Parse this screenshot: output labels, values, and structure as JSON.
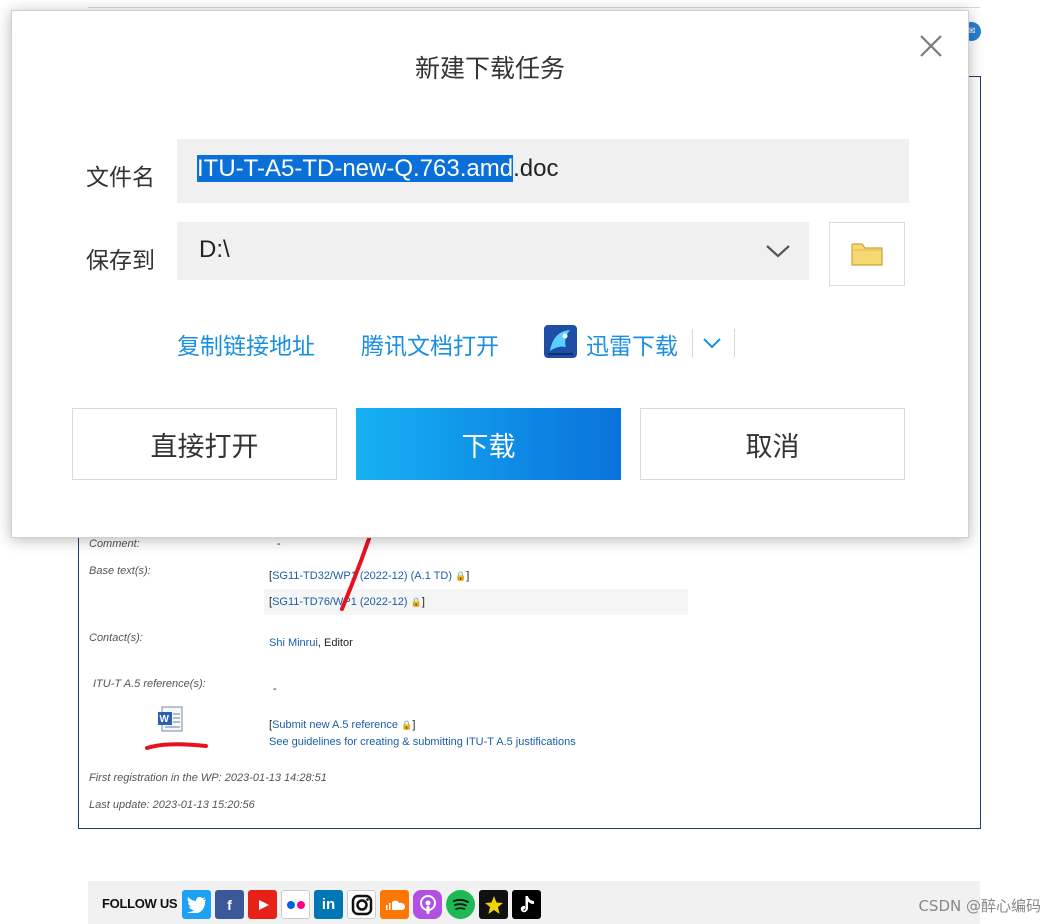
{
  "dialog": {
    "title": "新建下载任务",
    "filename_label": "文件名",
    "filename_selected": "ITU-T-A5-TD-new-Q.763.amd",
    "filename_ext": ".doc",
    "savepath_label": "保存到",
    "savepath_value": "D:\\",
    "links": {
      "copy_link": "复制链接地址",
      "tencent_docs": "腾讯文档打开",
      "xunlei": "迅雷下载"
    },
    "buttons": {
      "open_direct": "直接打开",
      "download": "下载",
      "cancel": "取消"
    },
    "icons": {
      "close": "close-icon",
      "dropdown": "chevron-down-icon",
      "folder": "folder-icon",
      "xunlei": "xunlei-icon"
    }
  },
  "page": {
    "comment_label": "Comment:",
    "comment_value": "-",
    "base_text_label": "Base text(s):",
    "base_text_1_bracket_open": "[",
    "base_text_1": "SG11-TD32/WP1 (2022-12) (A.1 TD)",
    "base_text_1_bracket_close": "]",
    "base_text_2_bracket_open": "[",
    "base_text_2": "SG11-TD76/WP1 (2022-12)",
    "base_text_2_bracket_close": "]",
    "contacts_label": "Contact(s):",
    "contact_name": "Shi Minrui",
    "contact_role": ", Editor",
    "a5_label": "ITU-T A.5 reference(s):",
    "a5_value": "-",
    "submit_bracket_open": "[",
    "submit_link": "Submit new A.5 reference",
    "submit_bracket_close": "]",
    "guidelines_link": "See guidelines for creating & submitting ITU-T A.5 justifications",
    "first_registration": "First registration in the WP: 2023-01-13 14:28:51",
    "last_update": "Last update: 2023-01-13 15:20:56"
  },
  "social": {
    "follow_label": "FOLLOW US",
    "icons": [
      "twitter-icon",
      "facebook-icon",
      "youtube-icon",
      "flickr-icon",
      "linkedin-icon",
      "instagram-icon",
      "soundcloud-icon",
      "podcasts-icon",
      "spotify-icon",
      "deezer-icon",
      "tiktok-icon"
    ]
  },
  "watermark": "CSDN @醉心编码",
  "colors": {
    "accent_link": "#1a8fe0",
    "download_button_start": "#16b2f2",
    "download_button_end": "#0a72dc",
    "selection": "#0a6fd8",
    "annotation_red": "#e8121f"
  }
}
